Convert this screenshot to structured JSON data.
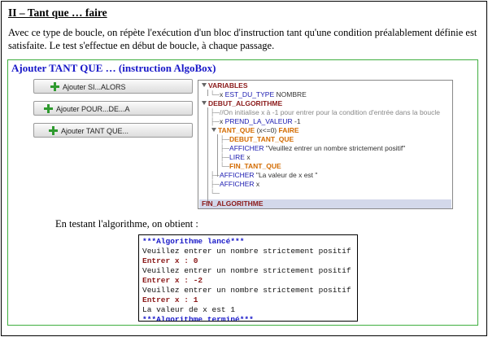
{
  "heading": "II – Tant que … faire",
  "intro": "Avec ce type de boucle, on répète l'exécution d'un bloc d'instruction tant qu'une condition préalablement définie est satisfaite. Le test s'effectue en début de boucle, à chaque passage.",
  "box": {
    "title": "Ajouter TANT QUE …  (instruction AlgoBox)",
    "buttons": [
      {
        "label": "Ajouter SI...ALORS",
        "icon": "plus-icon"
      },
      {
        "label": "Ajouter POUR...DE...A",
        "icon": "plus-icon"
      },
      {
        "label": "Ajouter TANT QUE...",
        "icon": "plus-icon"
      }
    ],
    "code": {
      "variables": "VARIABLES",
      "var_x": "x",
      "var_type": "EST_DU_TYPE",
      "var_nombre": "NOMBRE",
      "debut_algo": "DEBUT_ALGORITHME",
      "comment": "//On initialise x à -1 pour entrer pour la condition d'entrée dans la boucle",
      "init_x": "x",
      "init_kw": "PREND_LA_VALEUR",
      "init_val": "-1",
      "tq_kw": "TANT_QUE",
      "tq_cond": "(x<=0)",
      "tq_faire": "FAIRE",
      "debut_tq": "DEBUT_TANT_QUE",
      "afficher1_kw": "AFFICHER",
      "afficher1_txt": "\"Veuillez entrer un nombre strictement positif\"",
      "lire_kw": "LIRE",
      "lire_var": "x",
      "fin_tq": "FIN_TANT_QUE",
      "afficher2_kw": "AFFICHER",
      "afficher2_txt": "\"La valeur de x est \"",
      "afficher3_kw": "AFFICHER",
      "afficher3_txt": "x",
      "fin_algo": "FIN_ALGORITHME"
    },
    "result_label": "En testant l'algorithme, on obtient :",
    "console": [
      {
        "text": "***Algorithme lancé***",
        "style": "blue"
      },
      {
        "text": "Veuillez entrer un nombre strictement positif",
        "style": "black"
      },
      {
        "text": "Entrer x : 0",
        "style": "red"
      },
      {
        "text": "Veuillez entrer un nombre strictement positif",
        "style": "black"
      },
      {
        "text": "Entrer x : -2",
        "style": "red"
      },
      {
        "text": "Veuillez entrer un nombre strictement positif",
        "style": "black"
      },
      {
        "text": "Entrer x : 1",
        "style": "red"
      },
      {
        "text": "La valeur de x est 1",
        "style": "black"
      },
      {
        "text": "***Algorithme terminé***",
        "style": "blue"
      }
    ]
  },
  "colors": {
    "accent_blue": "#1818c8",
    "keyword_red": "#8b1a1a",
    "keyword_orange": "#d36b00",
    "box_border_green": "#3fae3f"
  }
}
